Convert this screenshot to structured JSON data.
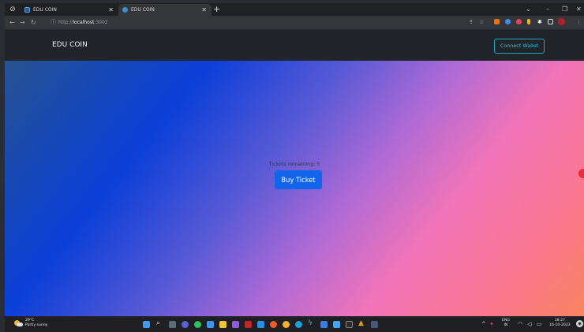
{
  "browser": {
    "tabs": [
      {
        "title": "EDU COIN"
      },
      {
        "title": "EDU COIN"
      }
    ],
    "new_tab": "+",
    "address": {
      "prefix": "http://",
      "host": "localhost",
      "suffix": ":3002"
    }
  },
  "page": {
    "brand": "EDU COIN",
    "connect_label": "Connect Wallet",
    "tickets_text": "Tickets remaining: 5",
    "buy_label": "Buy Ticket"
  },
  "taskbar": {
    "weather": {
      "temp": "29°C",
      "desc": "Partly sunny"
    },
    "language": {
      "lang": "ENG",
      "region": "IN"
    },
    "clock": {
      "time": "18:27",
      "date": "16-10-2023"
    }
  },
  "colors": {
    "navbar": "#212529",
    "connect_accent": "#1fa8c8",
    "buy_button": "#1366ea",
    "gradient": [
      "#27528f",
      "#0a3fd9",
      "#b06ad6",
      "#f374b8",
      "#f98460"
    ]
  },
  "icons": {
    "tab_controls": "extension-icon",
    "nav": [
      "back-arrow-icon",
      "forward-arrow-icon",
      "reload-icon"
    ],
    "omnibox": [
      "info-icon",
      "share-icon",
      "star-icon"
    ],
    "extensions": [
      "fox-extension-icon",
      "extension-icon-blue",
      "extension-icon-red",
      "extension-icon-yellow",
      "puzzle-icon",
      "sidebar-icon",
      "profile-avatar-icon",
      "menu-dots-icon"
    ]
  }
}
